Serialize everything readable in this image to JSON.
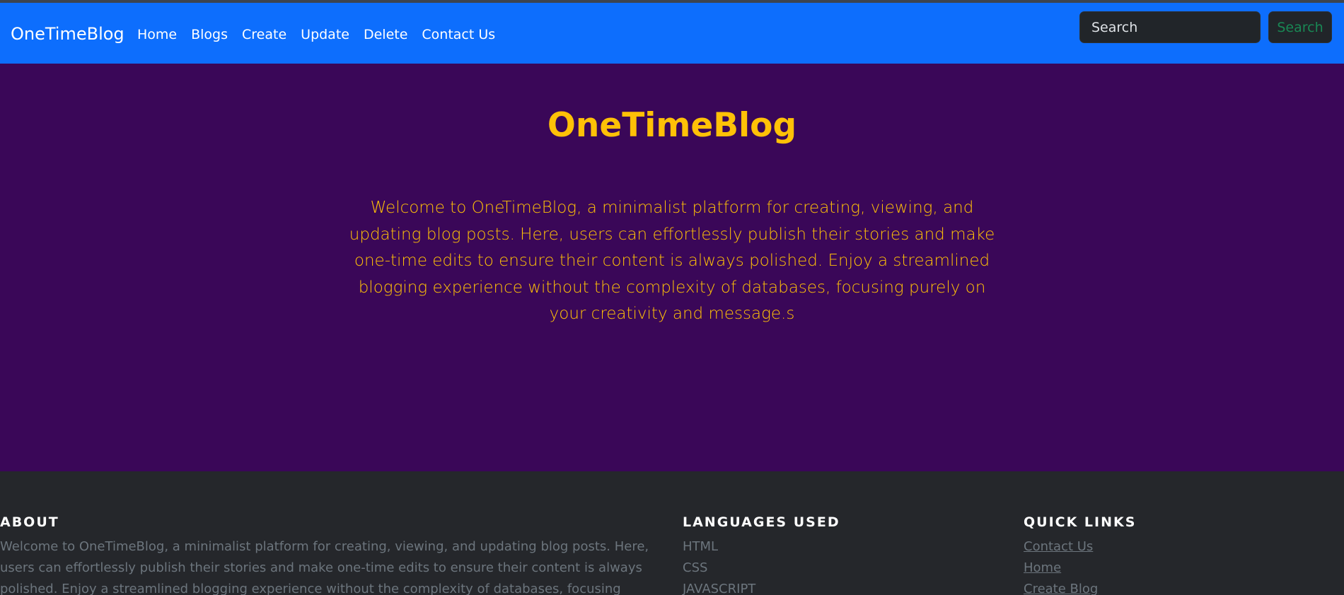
{
  "navbar": {
    "brand": "OneTimeBlog",
    "links": [
      {
        "label": "Home"
      },
      {
        "label": "Blogs"
      },
      {
        "label": "Create"
      },
      {
        "label": "Update"
      },
      {
        "label": "Delete"
      },
      {
        "label": "Contact Us"
      }
    ],
    "search": {
      "placeholder": "Search",
      "button_label": "Search"
    }
  },
  "hero": {
    "title": "OneTimeBlog",
    "text": "Welcome to OneTimeBlog, a minimalist platform for creating, viewing, and updating blog posts. Here, users can effortlessly publish their stories and make one-time edits to ensure their content is always polished. Enjoy a streamlined blogging experience without the complexity of databases, focusing purely on your creativity and message.s"
  },
  "footer": {
    "about": {
      "heading": "ABOUT",
      "text": "Welcome to OneTimeBlog, a minimalist platform for creating, viewing, and updating blog posts. Here, users can effortlessly publish their stories and make one-time edits to ensure their content is always polished. Enjoy a streamlined blogging experience without the complexity of databases, focusing purely on your creativity and"
    },
    "languages": {
      "heading": "LANGUAGES USED",
      "items": [
        "HTML",
        "CSS",
        "JAVASCRIPT"
      ]
    },
    "quick_links": {
      "heading": "QUICK LINKS",
      "items": [
        "Contact Us",
        "Home",
        "Create Blog"
      ]
    }
  },
  "colors": {
    "navbar": "#0d6efd",
    "hero_background": "#3a0758",
    "accent": "#ffc107",
    "footer_background": "#25272b",
    "search_button_text": "#198754"
  }
}
